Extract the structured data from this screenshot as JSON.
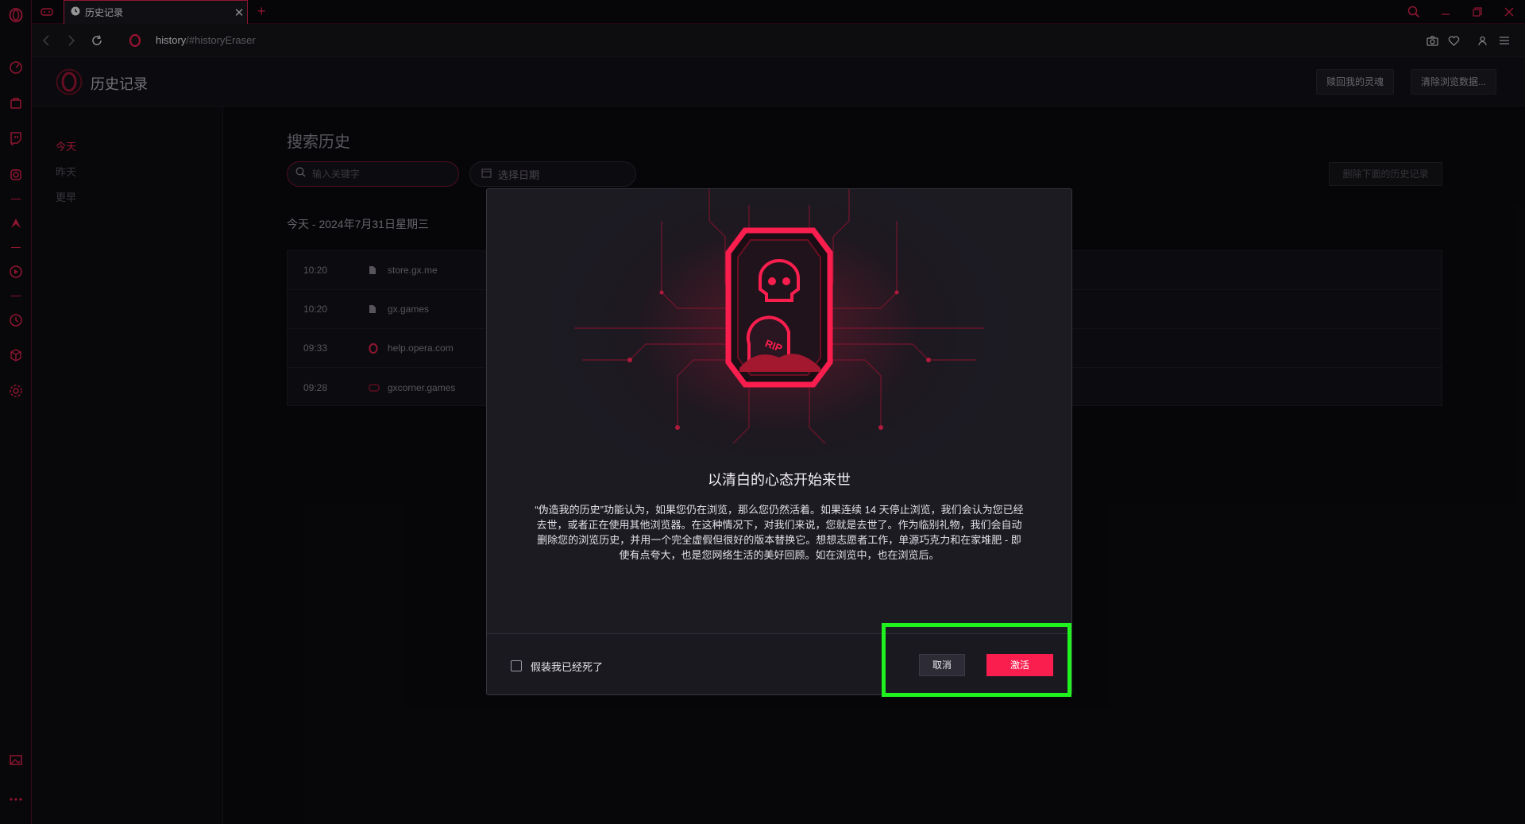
{
  "tab": {
    "title": "历史记录"
  },
  "address": {
    "url_bold": "history",
    "url_rest": "/#historyEraser"
  },
  "page_header": {
    "title": "历史记录",
    "buttons": [
      "赎回我的灵魂",
      "清除浏览数据..."
    ]
  },
  "history_nav": {
    "items": [
      "今天",
      "昨天",
      "更早"
    ]
  },
  "main": {
    "title": "搜索历史",
    "search_placeholder": "输入关键字",
    "date_placeholder": "选择日期",
    "delete_button": "删除下面的历史记录",
    "date_heading": "今天 - 2024年7月31日星期三",
    "entries": [
      {
        "time": "10:20",
        "site": "store.gx.me",
        "icon": "page-icon"
      },
      {
        "time": "10:20",
        "site": "gx.games",
        "icon": "page-icon"
      },
      {
        "time": "09:33",
        "site": "help.opera.com",
        "icon": "opera-icon"
      },
      {
        "time": "09:28",
        "site": "gxcorner.games",
        "icon": "gamepad-icon"
      }
    ]
  },
  "dialog": {
    "title": "以清白的心态开始来世",
    "badge_text": "RIP",
    "body": "“伪造我的历史”功能认为，如果您仍在浏览，那么您仍然活着。如果连续 14 天停止浏览，我们会认为您已经去世，或者正在使用其他浏览器。在这种情况下，对我们来说，您就是去世了。作为临别礼物，我们会自动删除您的浏览历史，并用一个完全虚假但很好的版本替换它。想想志愿者工作，单源巧克力和在家堆肥 - 即使有点夸大，也是您网络生活的美好回顾。如在浏览中，也在浏览后。",
    "checkbox_label": "假装我已经死了",
    "cancel": "取消",
    "activate": "激活"
  },
  "colors": {
    "accent": "#fa1e4e",
    "highlight": "#1ff21f",
    "bg": "#0b0a0f"
  }
}
